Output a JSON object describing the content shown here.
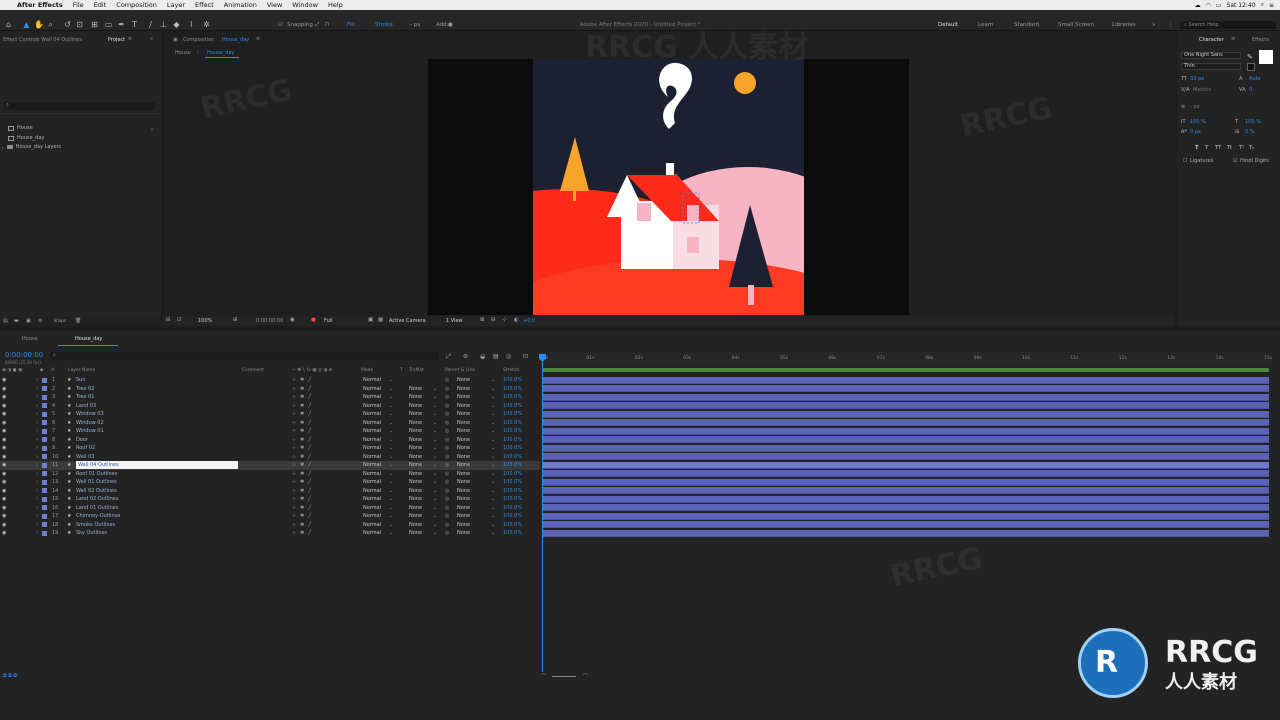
{
  "menubar": {
    "app": "After Effects",
    "items": [
      "File",
      "Edit",
      "Composition",
      "Layer",
      "Effect",
      "Animation",
      "View",
      "Window",
      "Help"
    ],
    "clock": "Sat 12:40"
  },
  "toolbar": {
    "snapping": "Snapping",
    "fill": "Fill:",
    "stroke": "Stroke:",
    "stroke_px": "- px",
    "add": "Add:",
    "title": "Adobe After Effects 2020 - Untitled Project *",
    "workspaces": [
      "Default",
      "Learn",
      "Standard",
      "Small Screen",
      "Libraries"
    ],
    "search_help": "Search Help"
  },
  "project": {
    "effect_controls_tab": "Effect Controls Wall 04 Outlines",
    "project_tab": "Project",
    "items": [
      "House",
      "House_day",
      "House_day Layers"
    ],
    "bpc": "8 bpc"
  },
  "viewer": {
    "comp_tab_prefix": "Composition",
    "comp_tab_name": "House_day",
    "breadcrumb_parent": "House",
    "breadcrumb_current": "House_day",
    "zoom": "100%",
    "timecode": "0:00:00:00",
    "resolution": "Full",
    "camera": "Active Camera",
    "views": "1 View",
    "exposure": "+0.0"
  },
  "character": {
    "tab": "Character",
    "effects_tab": "Effects",
    "font": "One Night Sans",
    "style": "Thin",
    "size": "33 px",
    "leading": "Auto",
    "kerning": "Metrics",
    "tracking": "0",
    "stroke_width": "- px",
    "vscale": "100 %",
    "hscale": "100 %",
    "baseline": "0 px",
    "tsume": "0 %",
    "ligatures": "Ligatures",
    "hindi_digits": "Hindi Digits"
  },
  "timeline": {
    "tabs": [
      "House",
      "House_day"
    ],
    "current_time": "0:00:00:00",
    "fps": "00000 (25.00 fps)",
    "headers": {
      "layer_name": "Layer Name",
      "comment": "Comment",
      "mode": "Mode",
      "t": "T",
      "trkmat": "TrkMat",
      "parent": "Parent & Link",
      "stretch": "Stretch"
    },
    "ruler": [
      "0s",
      "01s",
      "02s",
      "03s",
      "04s",
      "05s",
      "06s",
      "07s",
      "08s",
      "09s",
      "10s",
      "11s",
      "12s",
      "13s",
      "14s",
      "15s"
    ],
    "layers": [
      {
        "num": "1",
        "name": "Sun",
        "mode": "Normal",
        "trkmat": "",
        "parent": "None",
        "stretch": "100.0%"
      },
      {
        "num": "2",
        "name": "Tree 02",
        "mode": "Normal",
        "trkmat": "None",
        "parent": "None",
        "stretch": "100.0%"
      },
      {
        "num": "3",
        "name": "Tree 01",
        "mode": "Normal",
        "trkmat": "None",
        "parent": "None",
        "stretch": "100.0%"
      },
      {
        "num": "4",
        "name": "Land 03",
        "mode": "Normal",
        "trkmat": "None",
        "parent": "None",
        "stretch": "100.0%"
      },
      {
        "num": "5",
        "name": "Window 03",
        "mode": "Normal",
        "trkmat": "None",
        "parent": "None",
        "stretch": "100.0%"
      },
      {
        "num": "6",
        "name": "Window 02",
        "mode": "Normal",
        "trkmat": "None",
        "parent": "None",
        "stretch": "100.0%"
      },
      {
        "num": "7",
        "name": "Window 01",
        "mode": "Normal",
        "trkmat": "None",
        "parent": "None",
        "stretch": "100.0%"
      },
      {
        "num": "8",
        "name": "Door",
        "mode": "Normal",
        "trkmat": "None",
        "parent": "None",
        "stretch": "100.0%"
      },
      {
        "num": "9",
        "name": "Roof 02",
        "mode": "Normal",
        "trkmat": "None",
        "parent": "None",
        "stretch": "100.0%"
      },
      {
        "num": "10",
        "name": "Wall 03",
        "mode": "Normal",
        "trkmat": "None",
        "parent": "None",
        "stretch": "100.0%"
      },
      {
        "num": "11",
        "name": "Wall 04 Outlines",
        "mode": "Normal",
        "trkmat": "None",
        "parent": "None",
        "stretch": "100.0%"
      },
      {
        "num": "12",
        "name": "Roof 01 Outlines",
        "mode": "Normal",
        "trkmat": "None",
        "parent": "None",
        "stretch": "100.0%"
      },
      {
        "num": "13",
        "name": "Wall 01 Outlines",
        "mode": "Normal",
        "trkmat": "None",
        "parent": "None",
        "stretch": "100.0%"
      },
      {
        "num": "14",
        "name": "Wall 02 Outlines",
        "mode": "Normal",
        "trkmat": "None",
        "parent": "None",
        "stretch": "100.0%"
      },
      {
        "num": "15",
        "name": "Land 02 Outlines",
        "mode": "Normal",
        "trkmat": "None",
        "parent": "None",
        "stretch": "100.0%"
      },
      {
        "num": "16",
        "name": "Land 01 Outlines",
        "mode": "Normal",
        "trkmat": "None",
        "parent": "None",
        "stretch": "100.0%"
      },
      {
        "num": "17",
        "name": "Chimney Outlines",
        "mode": "Normal",
        "trkmat": "None",
        "parent": "None",
        "stretch": "100.0%"
      },
      {
        "num": "18",
        "name": "Smoke Outlines",
        "mode": "Normal",
        "trkmat": "None",
        "parent": "None",
        "stretch": "100.0%"
      },
      {
        "num": "19",
        "name": "Sky Outlines",
        "mode": "Normal",
        "trkmat": "None",
        "parent": "None",
        "stretch": "100.0%"
      }
    ],
    "selected_layer": "11"
  },
  "watermark": {
    "text": "RRCG",
    "subtext": "人人素材"
  },
  "colors": {
    "accent": "#2d8ceb",
    "sky": "#1c2030",
    "land_red": "#ff2a1a",
    "land_pink": "#f7b4c3",
    "sun": "#f6a42c",
    "tree_dark": "#1c2030"
  }
}
